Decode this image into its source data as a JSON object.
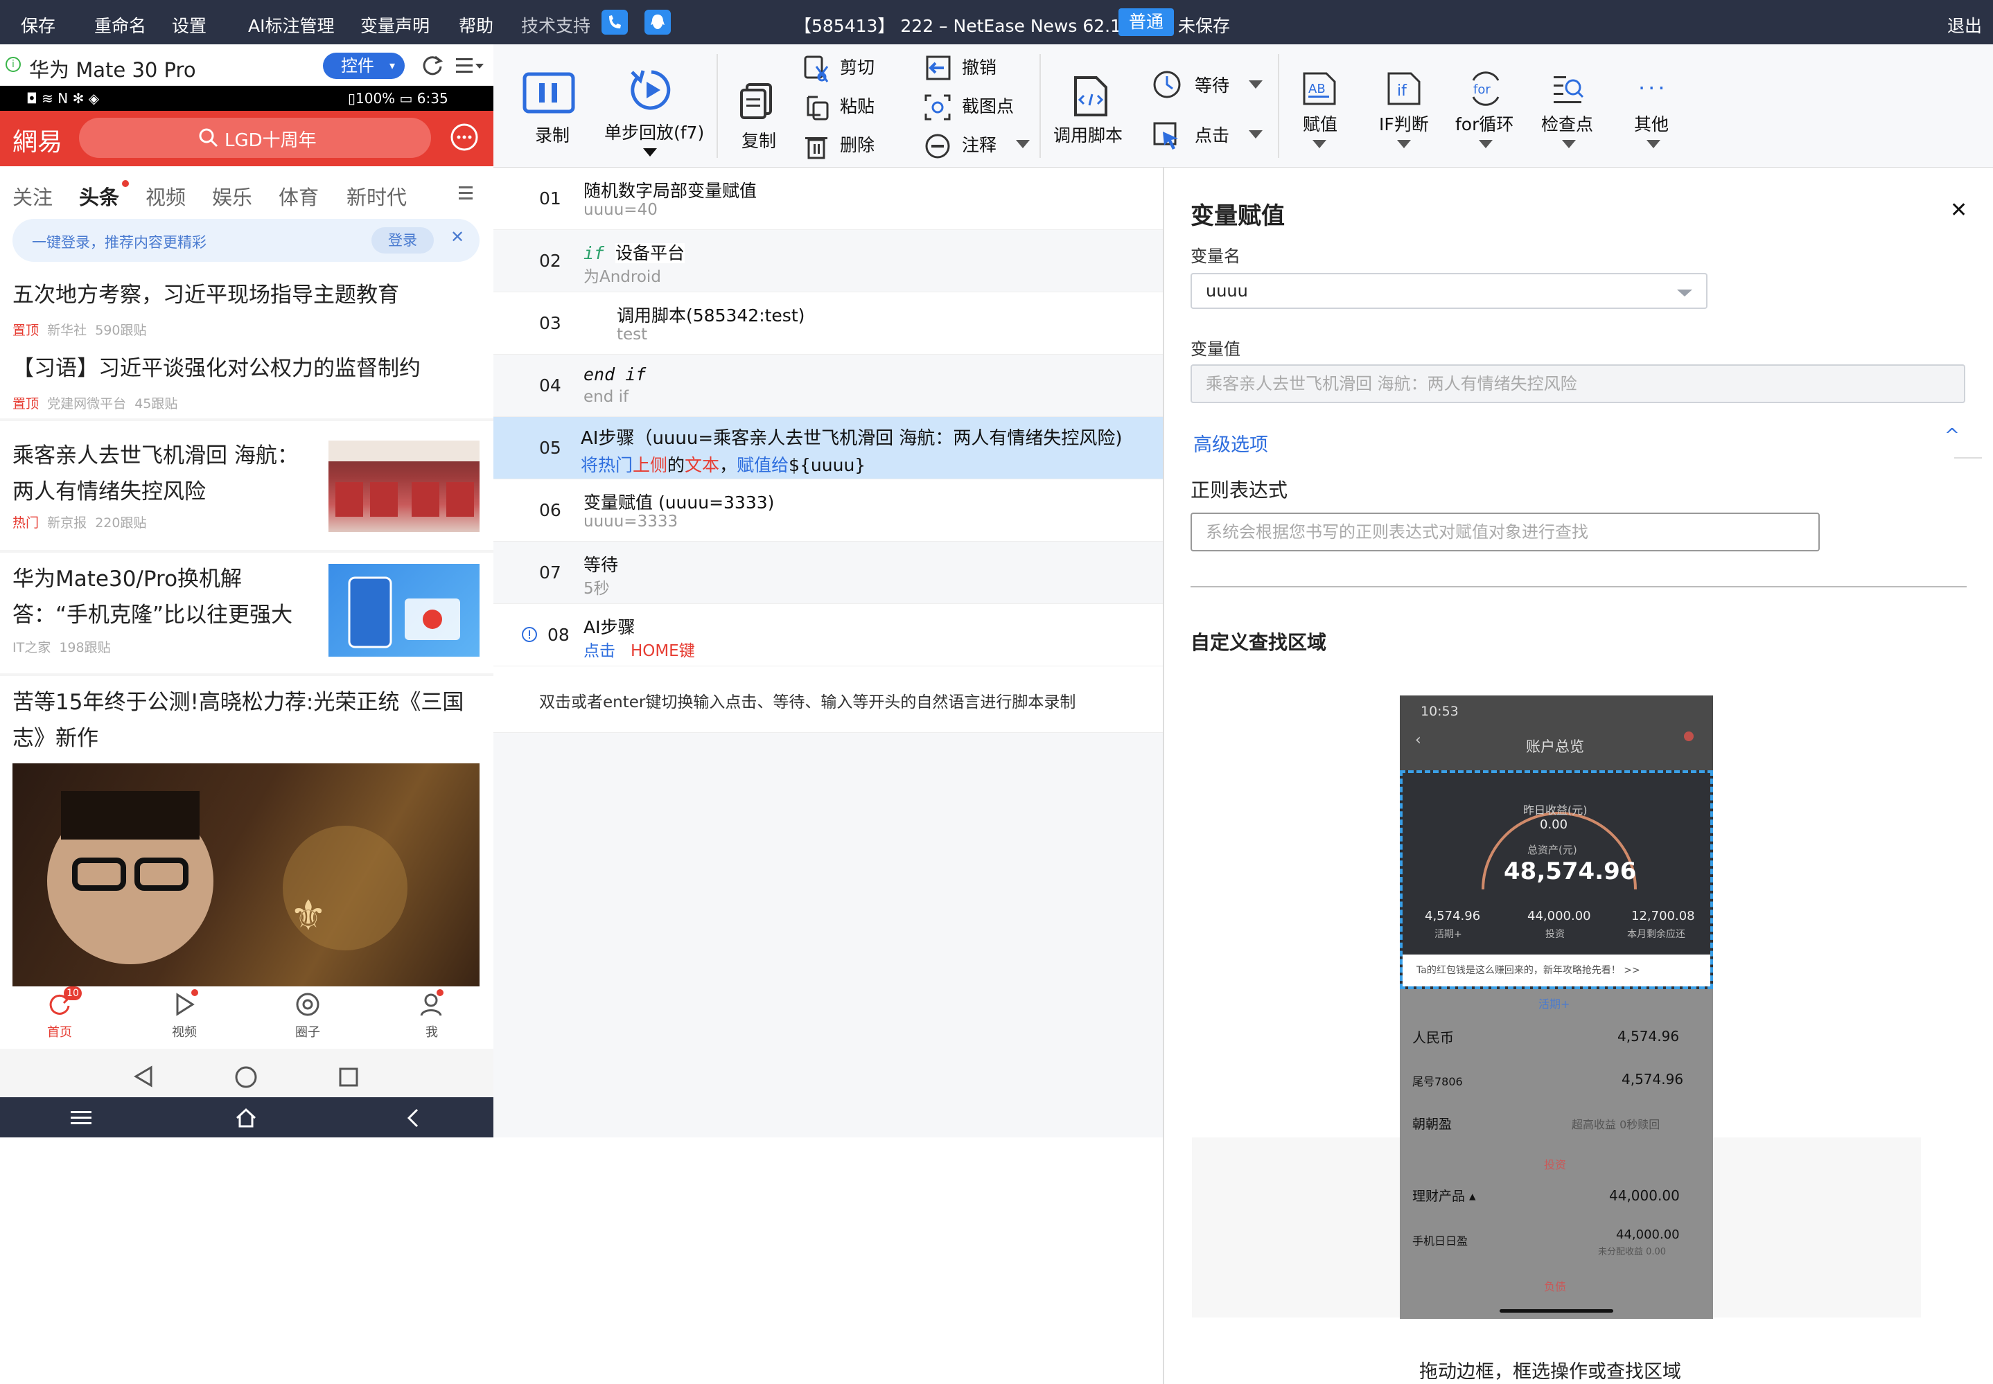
{
  "topbar": {
    "menu": [
      "保存",
      "重命名",
      "设置",
      "AI标注管理",
      "变量声明",
      "帮助",
      "技术支持"
    ],
    "title": "【585413】  222 – NetEase News 62.1*",
    "mode_badge": "普通",
    "save_status": "未保存",
    "logout": "退出"
  },
  "device": {
    "name": "华为 Mate 30 Pro",
    "control_btn": "控件",
    "status_left": "◘ ≋ N ✻ ◈",
    "status_right": "▯100% ▭ 6:35"
  },
  "app": {
    "logo": "網易",
    "search": "LGD十周年",
    "tabs": [
      "关注",
      "头条",
      "视频",
      "娱乐",
      "体育",
      "新时代"
    ],
    "login_banner": "一键登录，推荐内容更精彩",
    "login_btn": "登录",
    "news": [
      {
        "title": "五次地方考察，习近平现场指导主题教育",
        "tag": "置顶",
        "source": "新华社",
        "count": "590跟贴"
      },
      {
        "title": "【习语】习近平谈强化对公权力的监督制约",
        "tag": "置顶",
        "source": "党建网微平台",
        "count": "45跟贴"
      },
      {
        "title": "乘客亲人去世飞机滑回 海航：两人有情绪失控风险",
        "tag": "热门",
        "source": "新京报",
        "count": "220跟贴"
      },
      {
        "title": "华为Mate30/Pro换机解答：“手机克隆”比以往更强大",
        "tag": "",
        "source": "IT之家",
        "count": "198跟贴"
      },
      {
        "title": "苦等15年终于公测!高晓松力荐:光荣正统《三国志》新作"
      }
    ],
    "bottom_nav": [
      "首页",
      "视频",
      "圈子",
      "我"
    ],
    "home_badge": "10"
  },
  "toolbar": {
    "record": "录制",
    "replay": "单步回放(f7)",
    "copy": "复制",
    "cut": "剪切",
    "paste": "粘贴",
    "delete": "删除",
    "undo": "撤销",
    "screenshot": "截图点",
    "comment": "注释",
    "call_script": "调用脚本",
    "wait": "等待",
    "click": "点击",
    "assign": "赋值",
    "if": "IF判断",
    "for": "for循环",
    "checkpoint": "检查点",
    "more": "其他"
  },
  "steps": [
    {
      "num": "01",
      "line1": "随机数字局部变量赋值",
      "line2": "uuuu=40"
    },
    {
      "num": "02",
      "kw": "if",
      "line1": "设备平台",
      "line2": "为Android"
    },
    {
      "num": "03",
      "line1": "调用脚本(585342:test)",
      "line2": "test"
    },
    {
      "num": "04",
      "kw": "end if",
      "line2": "end if"
    },
    {
      "num": "05",
      "line1": "AI步骤（uuuu=乘客亲人去世飞机滑回 海航：两人有情绪失控风险)",
      "p1": "将热门",
      "p2": "上侧",
      "p3": "的",
      "p4": "文本",
      "p5": "，",
      "p6": "赋值给",
      "p7": "${uuuu}"
    },
    {
      "num": "06",
      "line1": "变量赋值 (uuuu=3333)",
      "line2": "uuuu=3333"
    },
    {
      "num": "07",
      "line1": "等待",
      "line2": "5秒"
    },
    {
      "num": "08",
      "line1": "AI步骤",
      "a1": "点击",
      "a2": "HOME键"
    }
  ],
  "steps_hint": "双击或者enter键切换输入点击、等待、输入等开头的自然语言进行脚本录制",
  "panel": {
    "title": "变量赋值",
    "var_name_label": "变量名",
    "var_name_value": "uuuu",
    "var_value_label": "变量值",
    "var_value_placeholder": "乘客亲人去世飞机滑回 海航：两人有情绪失控风险",
    "advanced": "高级选项",
    "regex_label": "正则表达式",
    "regex_placeholder": "系统会根据您书写的正则表达式对赋值对象进行查找",
    "custom_area": "自定义查找区域",
    "drag_hint": "拖动边框，框选操作或查找区域"
  },
  "preview": {
    "time": "10:53",
    "page_title": "账户总览",
    "yesterday_label": "昨日收益(元)",
    "yesterday_value": "0.00",
    "total_label": "总资产(元)",
    "total_value": "48,574.96",
    "stats": [
      {
        "v": "4,574.96",
        "l": "活期+"
      },
      {
        "v": "44,000.00",
        "l": "投资"
      },
      {
        "v": "12,700.08",
        "l": "本月剩余应还"
      }
    ],
    "tip": "Ta的红包钱是这么赚回来的，新年攻略抢先看！ >>",
    "sect1": "活期+",
    "rows": [
      {
        "l": "人民币",
        "v": "4,574.96"
      },
      {
        "l": "尾号7806",
        "v": "4,574.96"
      },
      {
        "l": "朝朝盈",
        "v": "超高收益 0秒赎回"
      }
    ],
    "sect2": "投资",
    "rows2": [
      {
        "l": "理财产品 ▴",
        "v": "44,000.00"
      },
      {
        "l": "手机日日盈",
        "v": "44,000.00"
      }
    ],
    "sub_note": "未分配收益 0.00",
    "sect3": "负债"
  },
  "colors": {
    "accent": "#2d6dde",
    "netease_red": "#e63c32",
    "selected_row": "#cfe5fb",
    "topbar": "#2b3245"
  }
}
